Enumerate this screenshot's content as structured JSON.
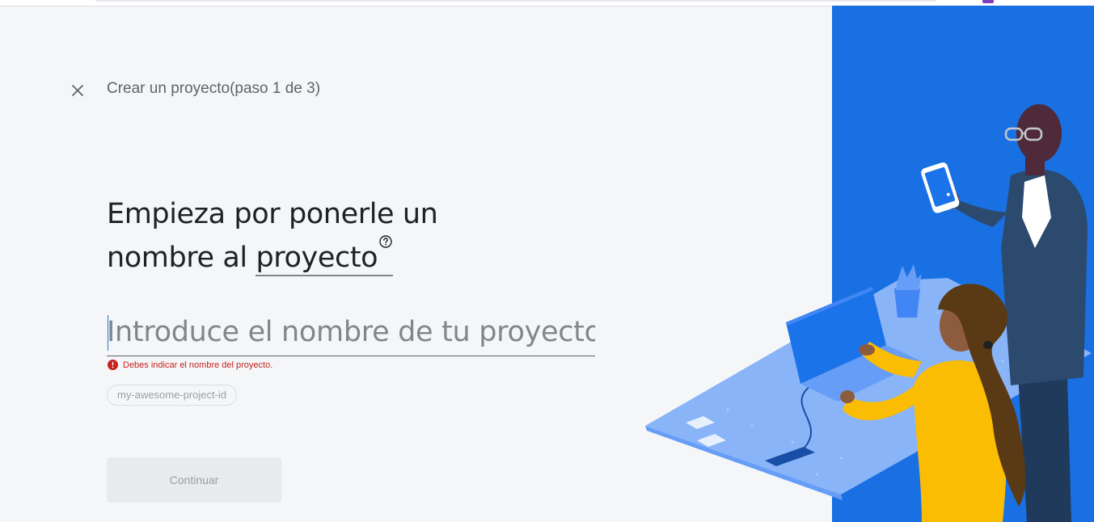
{
  "wizard": {
    "step_title": "Crear un proyecto(paso 1 de 3)",
    "headline_line1": "Empieza por ponerle un",
    "headline_line2_prefix": "nombre al ",
    "headline_link": "proyecto"
  },
  "project_name": {
    "value": "",
    "placeholder": "Introduce el nombre de tu proyecto",
    "error": "Debes indicar el nombre del proyecto."
  },
  "project_id": {
    "label": "my-awesome-project-id"
  },
  "actions": {
    "continue_label": "Continuar"
  },
  "colors": {
    "accent": "#1a73e8",
    "error": "#c5221f",
    "background": "#f5f6f8",
    "panel_blue": "#1a73e8"
  },
  "icons": {
    "close": "close-icon",
    "help": "help-circle-icon",
    "error": "error-icon"
  }
}
